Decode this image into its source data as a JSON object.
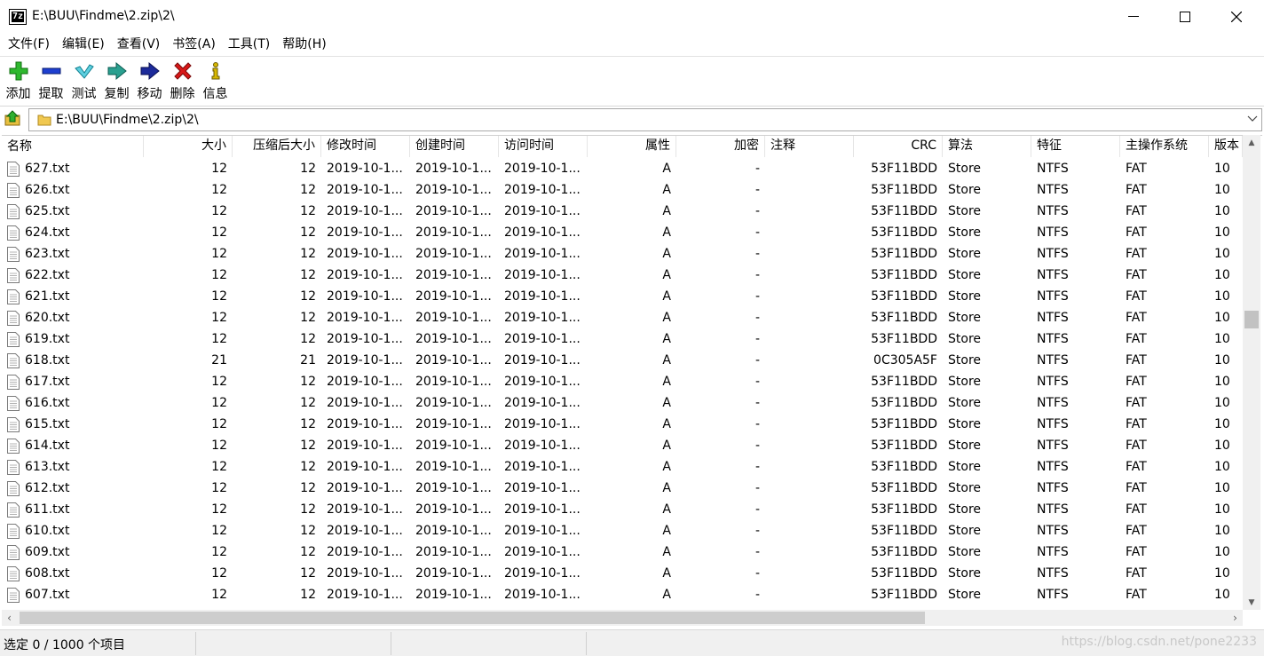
{
  "window": {
    "title": "E:\\BUU\\Findme\\2.zip\\2\\",
    "app_icon_text": "7z"
  },
  "menu": [
    "文件(F)",
    "编辑(E)",
    "查看(V)",
    "书签(A)",
    "工具(T)",
    "帮助(H)"
  ],
  "toolbar": [
    {
      "label": "添加",
      "icon": "plus-icon",
      "color": "#2fb82f"
    },
    {
      "label": "提取",
      "icon": "minus-icon",
      "color": "#1e3fd0"
    },
    {
      "label": "测试",
      "icon": "check-icon",
      "color": "#20b8c8"
    },
    {
      "label": "复制",
      "icon": "copy-arrow-icon",
      "color": "#1a9a8a"
    },
    {
      "label": "移动",
      "icon": "move-arrow-icon",
      "color": "#1c2a9a"
    },
    {
      "label": "删除",
      "icon": "delete-x-icon",
      "color": "#d81818"
    },
    {
      "label": "信息",
      "icon": "info-icon",
      "color": "#d8b800"
    }
  ],
  "address": {
    "path": "E:\\BUU\\Findme\\2.zip\\2\\"
  },
  "columns": [
    "名称",
    "大小",
    "压缩后大小",
    "修改时间",
    "创建时间",
    "访问时间",
    "属性",
    "加密",
    "注释",
    "CRC",
    "算法",
    "特征",
    "主操作系统",
    "版本"
  ],
  "files": [
    {
      "name": "627.txt",
      "size": "12",
      "packed": "12",
      "modified": "2019-10-1...",
      "created": "2019-10-1...",
      "accessed": "2019-10-1...",
      "attr": "A",
      "encrypted": "-",
      "comment": "",
      "crc": "53F11BDD",
      "method": "Store",
      "characteristics": "NTFS",
      "host_os": "FAT",
      "version": "10"
    },
    {
      "name": "626.txt",
      "size": "12",
      "packed": "12",
      "modified": "2019-10-1...",
      "created": "2019-10-1...",
      "accessed": "2019-10-1...",
      "attr": "A",
      "encrypted": "-",
      "comment": "",
      "crc": "53F11BDD",
      "method": "Store",
      "characteristics": "NTFS",
      "host_os": "FAT",
      "version": "10"
    },
    {
      "name": "625.txt",
      "size": "12",
      "packed": "12",
      "modified": "2019-10-1...",
      "created": "2019-10-1...",
      "accessed": "2019-10-1...",
      "attr": "A",
      "encrypted": "-",
      "comment": "",
      "crc": "53F11BDD",
      "method": "Store",
      "characteristics": "NTFS",
      "host_os": "FAT",
      "version": "10"
    },
    {
      "name": "624.txt",
      "size": "12",
      "packed": "12",
      "modified": "2019-10-1...",
      "created": "2019-10-1...",
      "accessed": "2019-10-1...",
      "attr": "A",
      "encrypted": "-",
      "comment": "",
      "crc": "53F11BDD",
      "method": "Store",
      "characteristics": "NTFS",
      "host_os": "FAT",
      "version": "10"
    },
    {
      "name": "623.txt",
      "size": "12",
      "packed": "12",
      "modified": "2019-10-1...",
      "created": "2019-10-1...",
      "accessed": "2019-10-1...",
      "attr": "A",
      "encrypted": "-",
      "comment": "",
      "crc": "53F11BDD",
      "method": "Store",
      "characteristics": "NTFS",
      "host_os": "FAT",
      "version": "10"
    },
    {
      "name": "622.txt",
      "size": "12",
      "packed": "12",
      "modified": "2019-10-1...",
      "created": "2019-10-1...",
      "accessed": "2019-10-1...",
      "attr": "A",
      "encrypted": "-",
      "comment": "",
      "crc": "53F11BDD",
      "method": "Store",
      "characteristics": "NTFS",
      "host_os": "FAT",
      "version": "10"
    },
    {
      "name": "621.txt",
      "size": "12",
      "packed": "12",
      "modified": "2019-10-1...",
      "created": "2019-10-1...",
      "accessed": "2019-10-1...",
      "attr": "A",
      "encrypted": "-",
      "comment": "",
      "crc": "53F11BDD",
      "method": "Store",
      "characteristics": "NTFS",
      "host_os": "FAT",
      "version": "10"
    },
    {
      "name": "620.txt",
      "size": "12",
      "packed": "12",
      "modified": "2019-10-1...",
      "created": "2019-10-1...",
      "accessed": "2019-10-1...",
      "attr": "A",
      "encrypted": "-",
      "comment": "",
      "crc": "53F11BDD",
      "method": "Store",
      "characteristics": "NTFS",
      "host_os": "FAT",
      "version": "10"
    },
    {
      "name": "619.txt",
      "size": "12",
      "packed": "12",
      "modified": "2019-10-1...",
      "created": "2019-10-1...",
      "accessed": "2019-10-1...",
      "attr": "A",
      "encrypted": "-",
      "comment": "",
      "crc": "53F11BDD",
      "method": "Store",
      "characteristics": "NTFS",
      "host_os": "FAT",
      "version": "10"
    },
    {
      "name": "618.txt",
      "size": "21",
      "packed": "21",
      "modified": "2019-10-1...",
      "created": "2019-10-1...",
      "accessed": "2019-10-1...",
      "attr": "A",
      "encrypted": "-",
      "comment": "",
      "crc": "0C305A5F",
      "method": "Store",
      "characteristics": "NTFS",
      "host_os": "FAT",
      "version": "10"
    },
    {
      "name": "617.txt",
      "size": "12",
      "packed": "12",
      "modified": "2019-10-1...",
      "created": "2019-10-1...",
      "accessed": "2019-10-1...",
      "attr": "A",
      "encrypted": "-",
      "comment": "",
      "crc": "53F11BDD",
      "method": "Store",
      "characteristics": "NTFS",
      "host_os": "FAT",
      "version": "10"
    },
    {
      "name": "616.txt",
      "size": "12",
      "packed": "12",
      "modified": "2019-10-1...",
      "created": "2019-10-1...",
      "accessed": "2019-10-1...",
      "attr": "A",
      "encrypted": "-",
      "comment": "",
      "crc": "53F11BDD",
      "method": "Store",
      "characteristics": "NTFS",
      "host_os": "FAT",
      "version": "10"
    },
    {
      "name": "615.txt",
      "size": "12",
      "packed": "12",
      "modified": "2019-10-1...",
      "created": "2019-10-1...",
      "accessed": "2019-10-1...",
      "attr": "A",
      "encrypted": "-",
      "comment": "",
      "crc": "53F11BDD",
      "method": "Store",
      "characteristics": "NTFS",
      "host_os": "FAT",
      "version": "10"
    },
    {
      "name": "614.txt",
      "size": "12",
      "packed": "12",
      "modified": "2019-10-1...",
      "created": "2019-10-1...",
      "accessed": "2019-10-1...",
      "attr": "A",
      "encrypted": "-",
      "comment": "",
      "crc": "53F11BDD",
      "method": "Store",
      "characteristics": "NTFS",
      "host_os": "FAT",
      "version": "10"
    },
    {
      "name": "613.txt",
      "size": "12",
      "packed": "12",
      "modified": "2019-10-1...",
      "created": "2019-10-1...",
      "accessed": "2019-10-1...",
      "attr": "A",
      "encrypted": "-",
      "comment": "",
      "crc": "53F11BDD",
      "method": "Store",
      "characteristics": "NTFS",
      "host_os": "FAT",
      "version": "10"
    },
    {
      "name": "612.txt",
      "size": "12",
      "packed": "12",
      "modified": "2019-10-1...",
      "created": "2019-10-1...",
      "accessed": "2019-10-1...",
      "attr": "A",
      "encrypted": "-",
      "comment": "",
      "crc": "53F11BDD",
      "method": "Store",
      "characteristics": "NTFS",
      "host_os": "FAT",
      "version": "10"
    },
    {
      "name": "611.txt",
      "size": "12",
      "packed": "12",
      "modified": "2019-10-1...",
      "created": "2019-10-1...",
      "accessed": "2019-10-1...",
      "attr": "A",
      "encrypted": "-",
      "comment": "",
      "crc": "53F11BDD",
      "method": "Store",
      "characteristics": "NTFS",
      "host_os": "FAT",
      "version": "10"
    },
    {
      "name": "610.txt",
      "size": "12",
      "packed": "12",
      "modified": "2019-10-1...",
      "created": "2019-10-1...",
      "accessed": "2019-10-1...",
      "attr": "A",
      "encrypted": "-",
      "comment": "",
      "crc": "53F11BDD",
      "method": "Store",
      "characteristics": "NTFS",
      "host_os": "FAT",
      "version": "10"
    },
    {
      "name": "609.txt",
      "size": "12",
      "packed": "12",
      "modified": "2019-10-1...",
      "created": "2019-10-1...",
      "accessed": "2019-10-1...",
      "attr": "A",
      "encrypted": "-",
      "comment": "",
      "crc": "53F11BDD",
      "method": "Store",
      "characteristics": "NTFS",
      "host_os": "FAT",
      "version": "10"
    },
    {
      "name": "608.txt",
      "size": "12",
      "packed": "12",
      "modified": "2019-10-1...",
      "created": "2019-10-1...",
      "accessed": "2019-10-1...",
      "attr": "A",
      "encrypted": "-",
      "comment": "",
      "crc": "53F11BDD",
      "method": "Store",
      "characteristics": "NTFS",
      "host_os": "FAT",
      "version": "10"
    },
    {
      "name": "607.txt",
      "size": "12",
      "packed": "12",
      "modified": "2019-10-1...",
      "created": "2019-10-1...",
      "accessed": "2019-10-1...",
      "attr": "A",
      "encrypted": "-",
      "comment": "",
      "crc": "53F11BDD",
      "method": "Store",
      "characteristics": "NTFS",
      "host_os": "FAT",
      "version": "10"
    }
  ],
  "status": {
    "selection": "选定 0 / 1000 个项目",
    "watermark": "https://blog.csdn.net/pone2233"
  }
}
